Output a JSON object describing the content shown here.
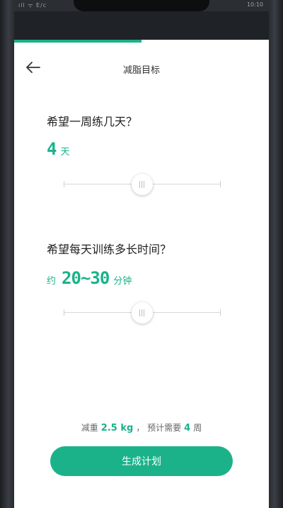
{
  "status": {
    "left": "ıll ᯤ E/c",
    "time": "10:10"
  },
  "progress_fraction": 0.5,
  "nav": {
    "title": "减脂目标"
  },
  "days_section": {
    "question": "希望一周练几天？",
    "value": "4",
    "unit": "天",
    "slider_fraction": 0.5
  },
  "duration_section": {
    "question": "希望每天训练多长时间？",
    "prefix": "约",
    "value": "20~30",
    "unit": "分钟",
    "slider_fraction": 0.5
  },
  "summary": {
    "label_reduce": "减重",
    "weight": "2.5 kg",
    "label_estimate": "， 预计需要",
    "weeks": "4",
    "weeks_unit": "周"
  },
  "cta": {
    "label": "生成计划"
  },
  "colors": {
    "accent": "#1bb28a"
  }
}
